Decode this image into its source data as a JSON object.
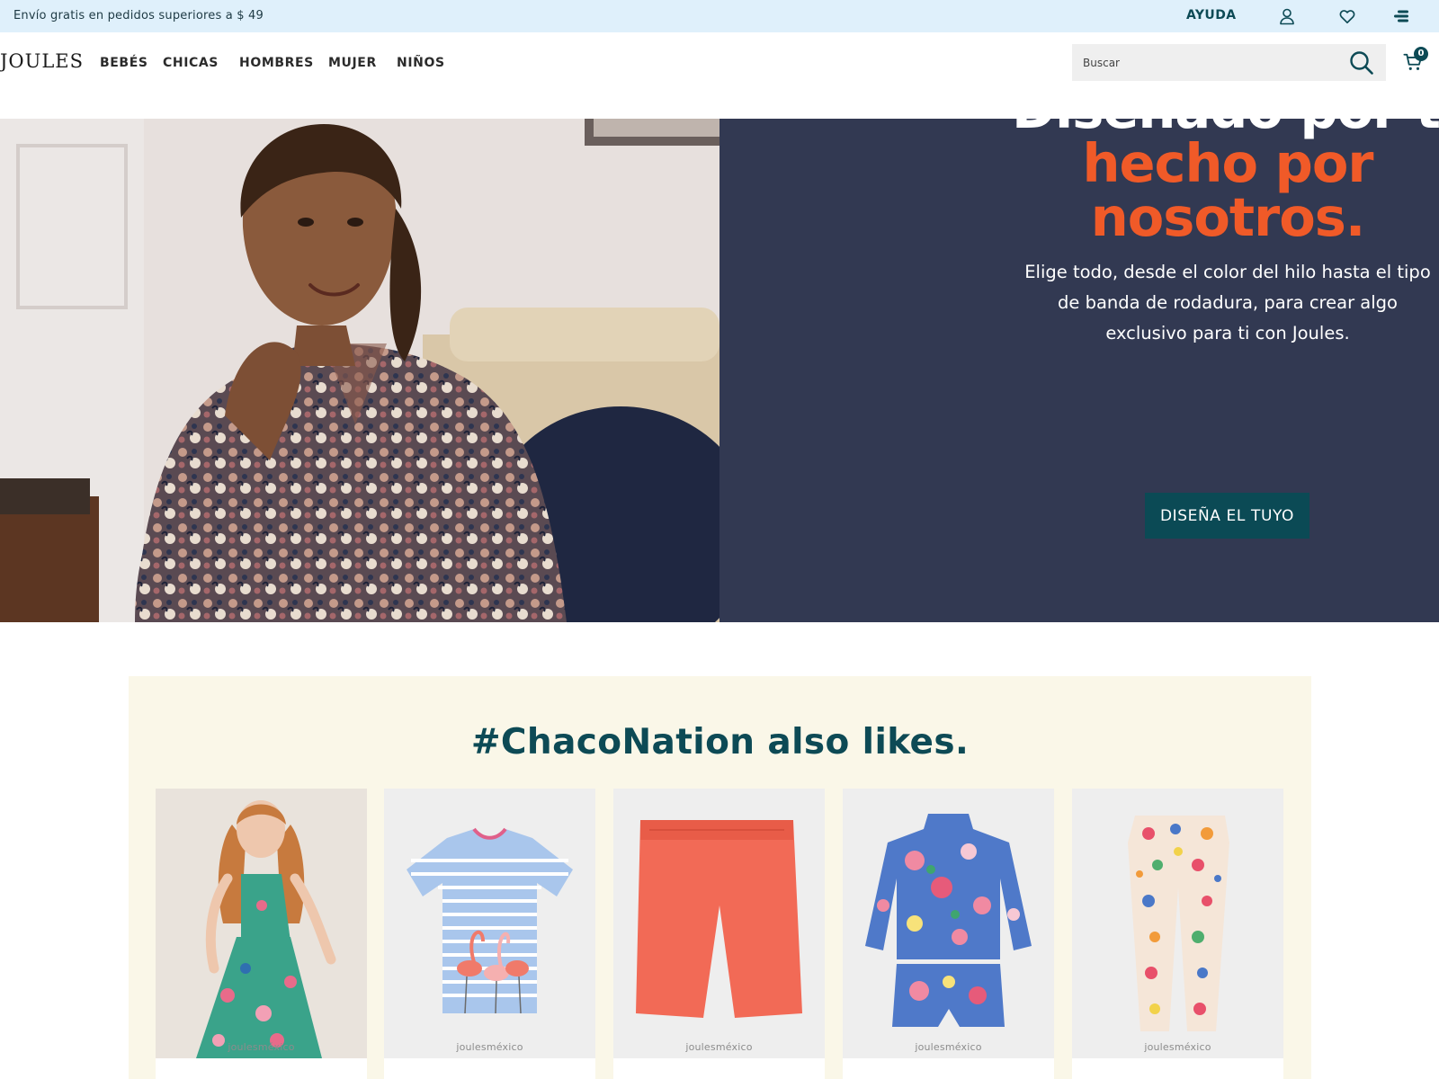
{
  "promo": {
    "text": "Envío gratis en pedidos superiores a $ 49"
  },
  "top_links": {
    "help": "AYUDA"
  },
  "icons": {
    "user": "user-icon",
    "wishlist": "heart-icon",
    "menu": "menu-icon",
    "search": "search-icon",
    "cart": "cart-icon"
  },
  "header": {
    "logo": "JOULES",
    "nav": [
      "BEBÉS",
      "CHICAS",
      "HOMBRES",
      "MUJER",
      "NIÑOS"
    ],
    "search": {
      "placeholder": "Buscar"
    },
    "cart": {
      "count": "0"
    }
  },
  "hero": {
    "title_line1": "Diseñado por ti,",
    "title_accent_line1": "hecho por",
    "title_accent_line2": "nosotros.",
    "subtitle": "Elige todo, desde el color del hilo hasta el tipo de banda de rodadura, para crear algo exclusivo para ti con Joules.",
    "cta": "DISEÑA EL TUYO"
  },
  "community": {
    "title": "#ChacoNation also likes.",
    "products": [
      {
        "image": "girl in floral dress",
        "watermark": "joulesméxico"
      },
      {
        "image": "striped flamingo t-shirt",
        "watermark": "joulesméxico"
      },
      {
        "image": "coral shorts",
        "watermark": "joulesméxico"
      },
      {
        "image": "floral swim set",
        "watermark": "joulesméxico"
      },
      {
        "image": "floral leggings",
        "watermark": "joulesméxico"
      }
    ]
  },
  "colors": {
    "promo_bg": "#dff0fb",
    "brand_teal": "#0d4a55",
    "hero_panel": "#323952",
    "accent_orange": "#f05a28",
    "community_bg": "#faf7e8"
  }
}
